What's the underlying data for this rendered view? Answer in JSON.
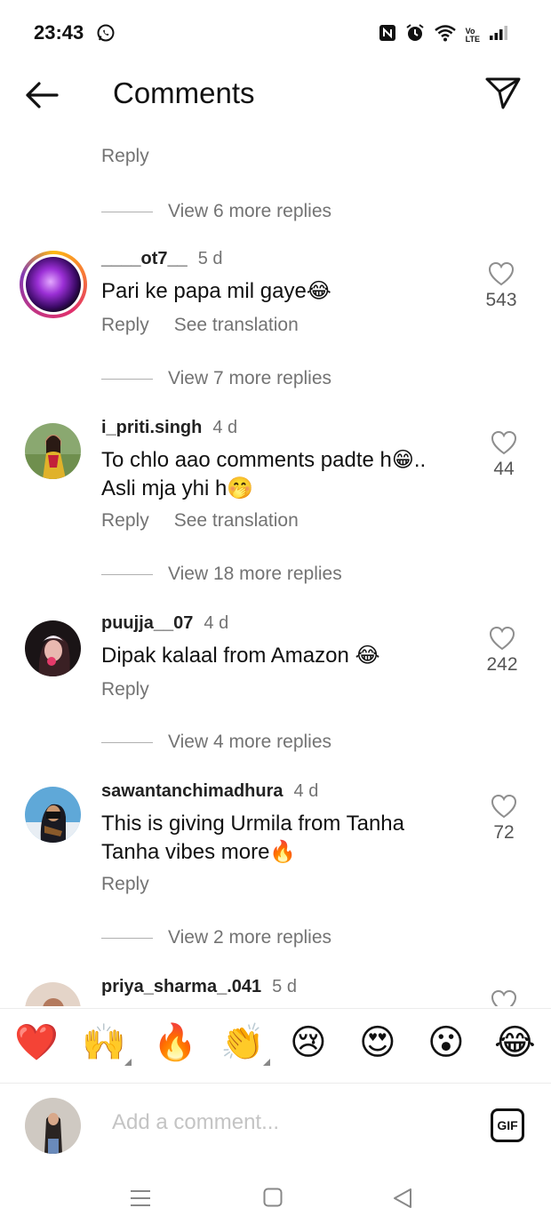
{
  "status_bar": {
    "time": "23:43",
    "icons": [
      "whatsapp-icon",
      "nfc-icon",
      "alarm-icon",
      "wifi-icon",
      "volte-icon",
      "signal-icon"
    ],
    "volte_top": "Vo",
    "volte_bottom": "LTE"
  },
  "header": {
    "title": "Comments"
  },
  "feed": {
    "reply_label": "Reply",
    "translation_label": "See translation",
    "top_view_replies": "View 6 more replies",
    "comments": [
      {
        "username": "____ot7__",
        "age": "5 d",
        "text": "Pari ke papa mil gaye😂",
        "likes": "543",
        "has_translation": true,
        "view_replies": "View 7 more replies"
      },
      {
        "username": "i_priti.singh",
        "age": "4 d",
        "text": "To chlo aao comments padte h😁.. Asli mja yhi h🤭",
        "likes": "44",
        "has_translation": true,
        "view_replies": "View 18 more replies"
      },
      {
        "username": "puujja__07",
        "age": "4 d",
        "text": "Dipak kalaal from Amazon 😂",
        "likes": "242",
        "has_translation": false,
        "view_replies": "View 4 more replies"
      },
      {
        "username": "sawantanchimadhura",
        "age": "4 d",
        "text": "This is giving Urmila from Tanha Tanha vibes more🔥",
        "likes": "72",
        "has_translation": false,
        "view_replies": "View 2 more replies"
      },
      {
        "username": "priya_sharma_.041",
        "age": "5 d",
        "text": "",
        "likes": "",
        "has_translation": false,
        "view_replies": ""
      }
    ]
  },
  "emoji_bar": {
    "emojis": [
      "❤️",
      "🙌",
      "🔥",
      "👏",
      "😢",
      "😍",
      "😮",
      "😂"
    ]
  },
  "compose": {
    "placeholder": "Add a comment...",
    "gif_label": "GIF"
  },
  "colors": {
    "secondary_text": "#737373",
    "like_heart": "#8e8e8e",
    "story_ring": "#e1306c"
  }
}
